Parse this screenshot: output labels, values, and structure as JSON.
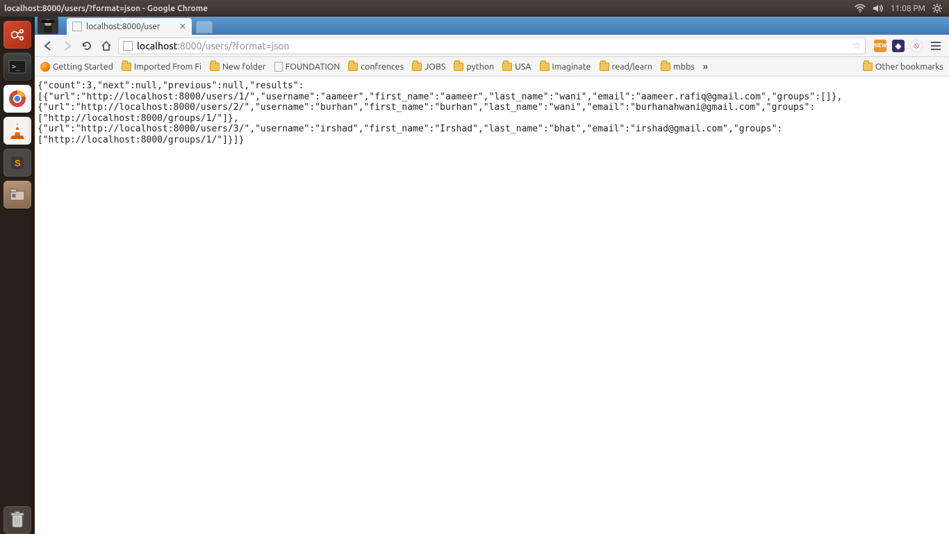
{
  "panel": {
    "title": "localhost:8000/users/?format=json - Google Chrome",
    "time": "11:08 PM"
  },
  "tabs": {
    "active_title": "localhost:8000/user"
  },
  "address": {
    "host": "localhost",
    "rest": ":8000/users/?format=json"
  },
  "bookmarks": {
    "b0": "Getting Started",
    "b1": "Imported From Fi",
    "b2": "New folder",
    "b3": "FOUNDATION",
    "b4": "confrences",
    "b5": "JOBS",
    "b6": "python",
    "b7": "USA",
    "b8": "Imaginate",
    "b9": "read/learn",
    "b10": "mbbs",
    "overflow": "»",
    "other": "Other bookmarks"
  },
  "body_text": "{\"count\":3,\"next\":null,\"previous\":null,\"results\":\n[{\"url\":\"http://localhost:8000/users/1/\",\"username\":\"aameer\",\"first_name\":\"aameer\",\"last_name\":\"wani\",\"email\":\"aameer.rafiq@gmail.com\",\"groups\":[]},\n{\"url\":\"http://localhost:8000/users/2/\",\"username\":\"burhan\",\"first_name\":\"burhan\",\"last_name\":\"wani\",\"email\":\"burhanahwani@gmail.com\",\"groups\":\n[\"http://localhost:8000/groups/1/\"]},\n{\"url\":\"http://localhost:8000/users/3/\",\"username\":\"irshad\",\"first_name\":\"Irshad\",\"last_name\":\"bhat\",\"email\":\"irshad@gmail.com\",\"groups\":\n[\"http://localhost:8000/groups/1/\"]}]}"
}
